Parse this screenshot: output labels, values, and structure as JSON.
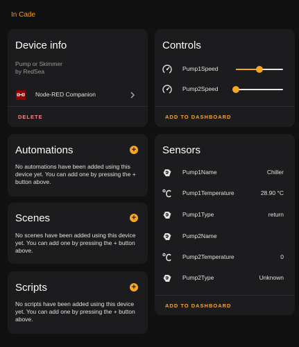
{
  "header": {
    "area_link": "In Cade"
  },
  "device_info": {
    "title": "Device info",
    "model": "Pump or Skimmer",
    "manufacturer": "by RedSea",
    "integration": "Node-RED Companion",
    "delete_label": "DELETE"
  },
  "controls": {
    "title": "Controls",
    "items": [
      {
        "name": "Pump1Speed",
        "level": 0.5
      },
      {
        "name": "Pump2Speed",
        "level": 0.0
      }
    ],
    "add_label": "ADD TO DASHBOARD"
  },
  "automations": {
    "title": "Automations",
    "text": "No automations have been added using this device yet. You can add one by pressing the + button above."
  },
  "scenes": {
    "title": "Scenes",
    "text": "No scenes have been added using this device yet. You can add one by pressing the + button above."
  },
  "scripts": {
    "title": "Scripts",
    "text": "No scripts have been added using this device yet. You can add one by pressing the + button above."
  },
  "sensors": {
    "title": "Sensors",
    "items": [
      {
        "name": "Pump1Name",
        "value": "Chiller",
        "icon": "pump-icon"
      },
      {
        "name": "Pump1Temperature",
        "value": "28.90 °C",
        "icon": "celsius-icon"
      },
      {
        "name": "Pump1Type",
        "value": "return",
        "icon": "pump-icon"
      },
      {
        "name": "Pump2Name",
        "value": "",
        "icon": "pump-icon"
      },
      {
        "name": "Pump2Temperature",
        "value": "0",
        "icon": "celsius-icon"
      },
      {
        "name": "Pump2Type",
        "value": "Unknown",
        "icon": "pump-icon"
      }
    ],
    "add_label": "ADD TO DASHBOARD"
  },
  "colors": {
    "accent": "#f5a623",
    "area_link": "#ff9800",
    "delete": "#f08a8a",
    "card": "#1c1c1e",
    "background": "#111111"
  }
}
